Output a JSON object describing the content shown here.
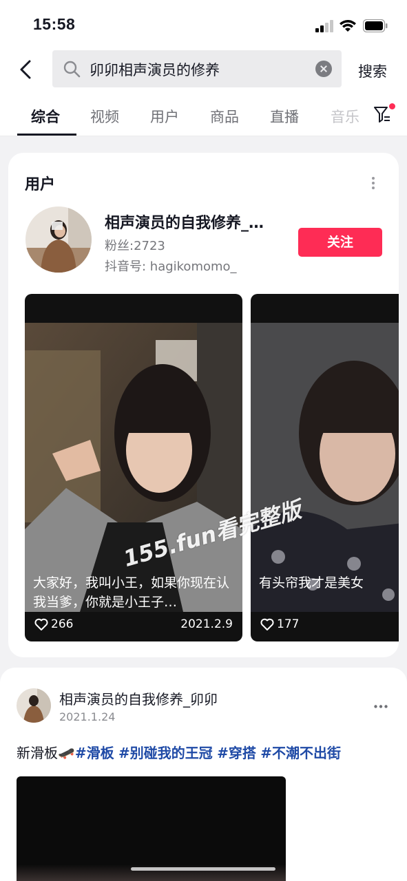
{
  "status_bar": {
    "time": "15:58"
  },
  "search": {
    "query": "卯卯相声演员的修养",
    "submit_label": "搜索"
  },
  "tabs": [
    {
      "label": "综合",
      "active": true
    },
    {
      "label": "视频"
    },
    {
      "label": "用户"
    },
    {
      "label": "商品"
    },
    {
      "label": "直播"
    },
    {
      "label": "音乐"
    }
  ],
  "user_section": {
    "title": "用户",
    "user": {
      "name": "相声演员的自我修养_…",
      "fans": "粉丝:2723",
      "douyin_id": "抖音号: hagikomomo_",
      "follow_label": "关注"
    },
    "videos": [
      {
        "caption": "大家好，我叫小王，如果你现在认我当爹，你就是小王子…",
        "likes": "266",
        "date": "2021.2.9"
      },
      {
        "caption": "有头帘我才是美女",
        "likes": "177"
      }
    ],
    "watermark": "155.fun看完整版"
  },
  "post": {
    "author": "相声演员的自我修养_卯卯",
    "date": "2021.1.24",
    "text_prefix": "新滑板🛹",
    "hashtags": [
      "#滑板",
      "#别碰我的王冠",
      "#穿搭",
      "#不潮不出街"
    ]
  },
  "colors": {
    "accent": "#fe2c55",
    "hashtag": "#1f4aa6"
  }
}
